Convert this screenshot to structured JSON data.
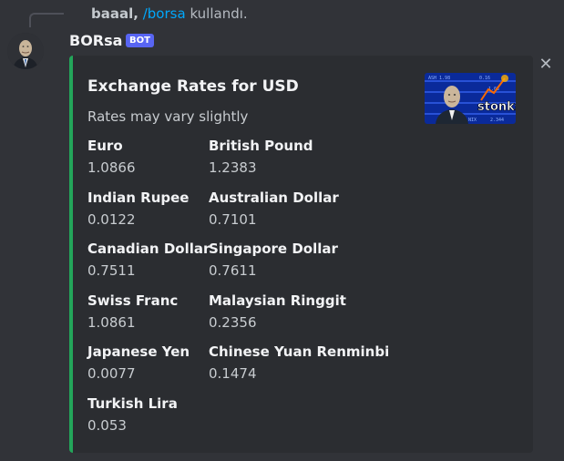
{
  "reply": {
    "user": "baaal,",
    "command": "/borsa",
    "suffix": "kullandı."
  },
  "message": {
    "username": "BORsa",
    "bot_tag": "BOT"
  },
  "embed": {
    "accent_color": "#23a55a",
    "title": "Exchange Rates for USD",
    "description": "Rates may vary slightly",
    "thumbnail_text": "stonks",
    "fields": [
      {
        "name": "Euro",
        "value": "1.0866"
      },
      {
        "name": "British Pound",
        "value": "1.2383"
      },
      {
        "name": "Indian Rupee",
        "value": "0.0122"
      },
      {
        "name": "Australian Dollar",
        "value": "0.7101"
      },
      {
        "name": "Canadian Dollar",
        "value": "0.7511"
      },
      {
        "name": "Singapore Dollar",
        "value": "0.7611"
      },
      {
        "name": "Swiss Franc",
        "value": "1.0861"
      },
      {
        "name": "Malaysian Ringgit",
        "value": "0.2356"
      },
      {
        "name": "Japanese Yen",
        "value": "0.0077"
      },
      {
        "name": "Chinese Yuan Renminbi",
        "value": "0.1474"
      },
      {
        "name": "Turkish Lira",
        "value": "0.053"
      }
    ]
  }
}
